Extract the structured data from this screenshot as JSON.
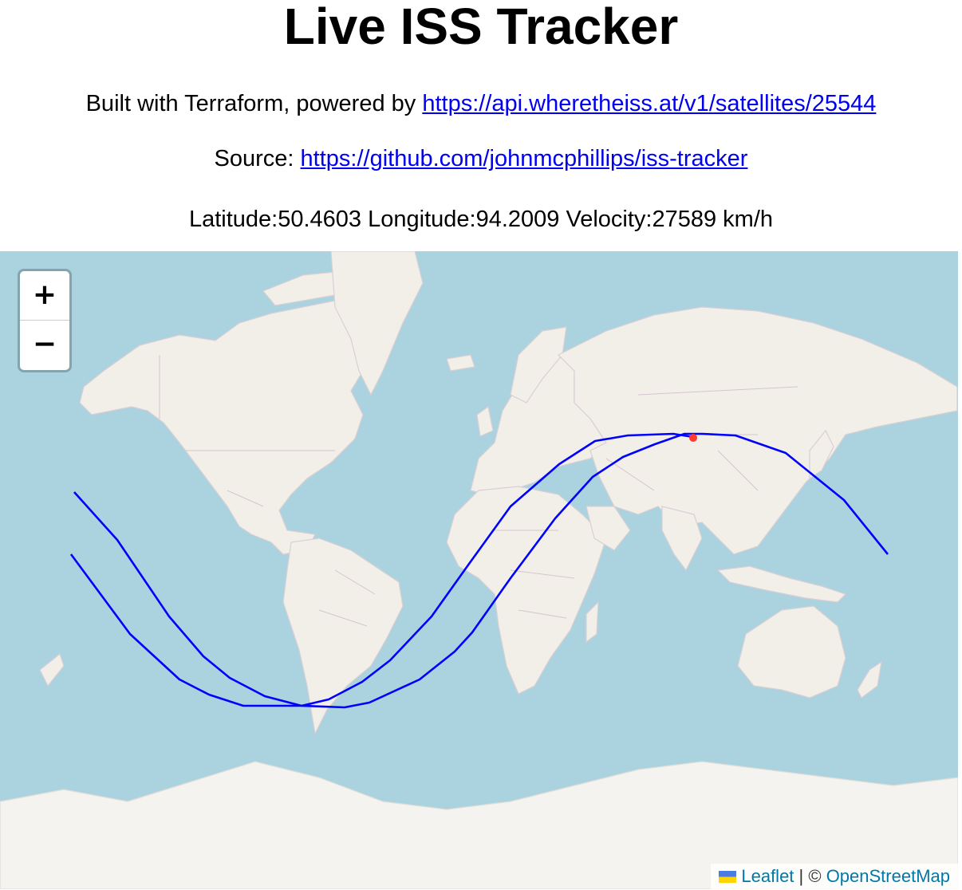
{
  "header": {
    "title": "Live ISS Tracker",
    "credit_prefix": "Built with Terraform, powered by ",
    "api_link": "https://api.wheretheiss.at/v1/satellites/25544",
    "source_prefix": "Source: ",
    "source_link": "https://github.com/johnmcphillips/iss-tracker"
  },
  "stats": {
    "latitude_label": "Latitude:",
    "latitude": "50.4603",
    "longitude_label": "Longitude:",
    "longitude": "94.2009",
    "velocity_label": "Velocity:",
    "velocity": "27589 km/h"
  },
  "map": {
    "zoom_in_label": "+",
    "zoom_out_label": "−",
    "attribution_leaflet": "Leaflet",
    "attribution_sep": " | © ",
    "attribution_osm": "OpenStreetMap",
    "colors": {
      "water": "#aad3df",
      "land": "#f2efe9",
      "ice": "#f5f3ef",
      "track": "#0000ff",
      "iss_marker": "#ff3b30"
    },
    "iss_position": {
      "lat": 50.4603,
      "lon": 94.2009
    }
  }
}
